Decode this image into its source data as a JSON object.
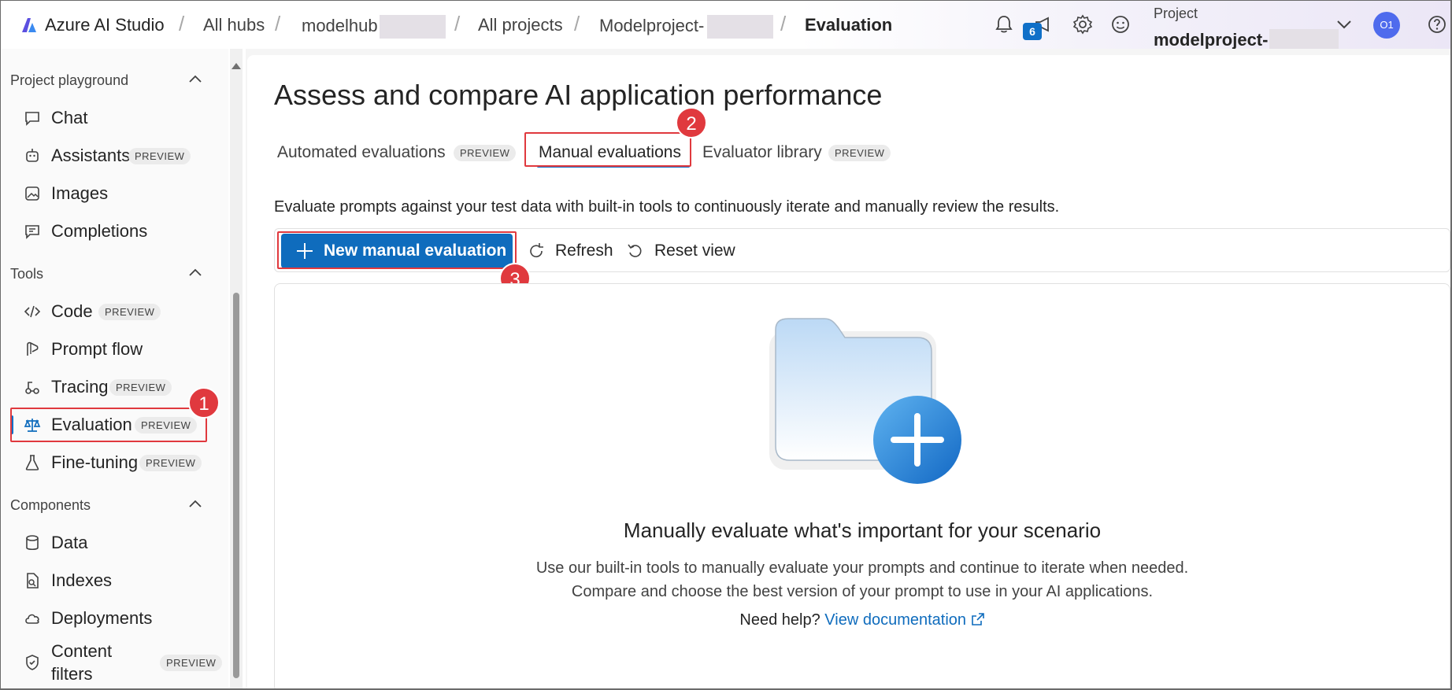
{
  "topbar": {
    "brand": "Azure AI Studio",
    "breadcrumbs": [
      {
        "label": "All hubs"
      },
      {
        "label": "modelhub"
      },
      {
        "label": "All projects"
      },
      {
        "label": "Modelproject-"
      },
      {
        "label": "Evaluation"
      }
    ],
    "notification_count": "6",
    "project_label": "Project",
    "project_name": "modelproject-",
    "avatar_initials": "O1",
    "icons": [
      "bell-icon",
      "megaphone-icon",
      "gear-icon",
      "smiley-icon",
      "chevron-down-icon",
      "help-icon"
    ]
  },
  "sidebar": {
    "sections": [
      {
        "title": "Project playground",
        "items": [
          {
            "label": "Chat",
            "icon": "chat-icon"
          },
          {
            "label": "Assistants",
            "icon": "assistant-icon",
            "badge": "PREVIEW"
          },
          {
            "label": "Images",
            "icon": "images-icon"
          },
          {
            "label": "Completions",
            "icon": "completions-icon"
          }
        ]
      },
      {
        "title": "Tools",
        "items": [
          {
            "label": "Code",
            "icon": "code-icon",
            "badge": "PREVIEW"
          },
          {
            "label": "Prompt flow",
            "icon": "prompt-flow-icon"
          },
          {
            "label": "Tracing",
            "icon": "tracing-icon",
            "badge": "PREVIEW"
          },
          {
            "label": "Evaluation",
            "icon": "scales-icon",
            "badge": "PREVIEW",
            "selected": true
          },
          {
            "label": "Fine-tuning",
            "icon": "flask-icon",
            "badge": "PREVIEW"
          }
        ]
      },
      {
        "title": "Components",
        "items": [
          {
            "label": "Data",
            "icon": "database-icon"
          },
          {
            "label": "Indexes",
            "icon": "indexes-icon"
          },
          {
            "label": "Deployments",
            "icon": "cloud-icon"
          },
          {
            "label": "Content filters",
            "icon": "shield-icon",
            "badge": "PREVIEW"
          }
        ]
      }
    ]
  },
  "main": {
    "title": "Assess and compare AI application performance",
    "tabs": [
      {
        "label": "Automated evaluations",
        "badge": "PREVIEW"
      },
      {
        "label": "Manual evaluations",
        "active": true
      },
      {
        "label": "Evaluator library",
        "badge": "PREVIEW"
      }
    ],
    "description": "Evaluate prompts against your test data with built-in tools to continuously iterate and manually review the results.",
    "toolbar": {
      "new_label": "New manual evaluation",
      "refresh_label": "Refresh",
      "reset_label": "Reset view"
    },
    "empty_state": {
      "title": "Manually evaluate what's important for your scenario",
      "line1": "Use our built-in tools to manually evaluate your prompts and continue to iterate when needed.",
      "line2": "Compare and choose the best version of your prompt to use in your AI applications.",
      "help_prefix": "Need help?",
      "help_link": "View documentation"
    }
  },
  "annotations": {
    "step1": "1",
    "step2": "2",
    "step3": "3"
  },
  "colors": {
    "accent": "#0f6cbd",
    "annotation": "#e0393e"
  }
}
